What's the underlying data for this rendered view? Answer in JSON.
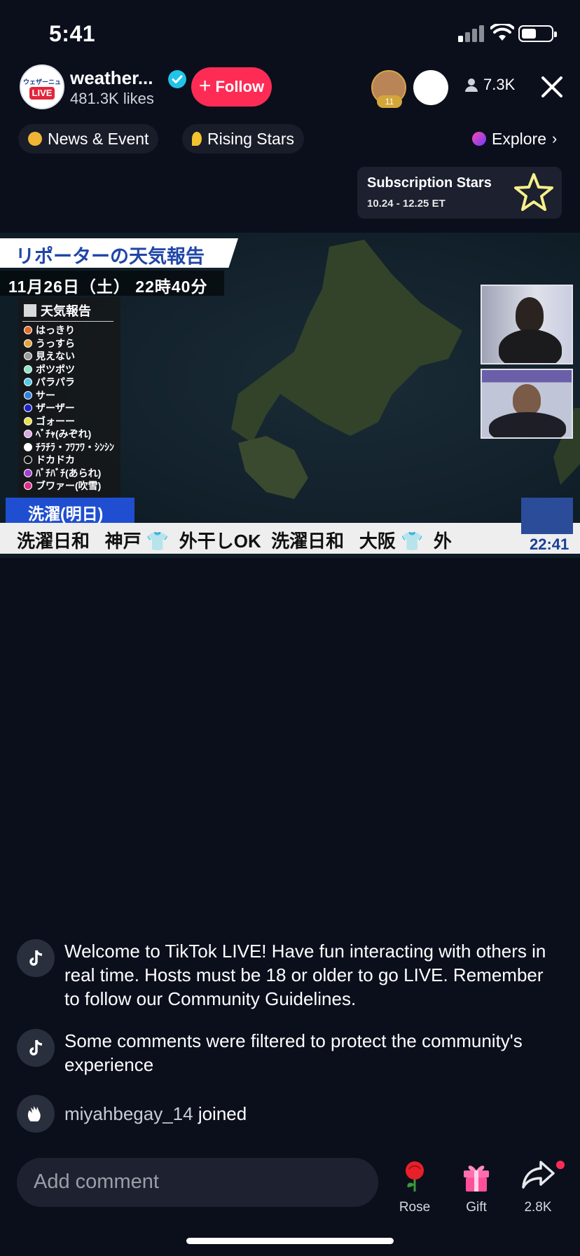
{
  "status": {
    "time": "5:41"
  },
  "header": {
    "host_name": "weather...",
    "host_likes": "481.3K likes",
    "avatar_top_text": "ウェザーニュース",
    "avatar_live_text": "LIVE",
    "follow_label": "Follow",
    "viewer_badge": "11",
    "viewer_count": "7.3K"
  },
  "categories": [
    {
      "label": "News & Event",
      "color": "#f0b535"
    },
    {
      "label": "Rising Stars",
      "color": "#f2c230"
    },
    {
      "label": "Explore",
      "color": "#e24fd0"
    }
  ],
  "subscription": {
    "title": "Subscription Stars",
    "dates": "10.24 - 12.25 ET"
  },
  "broadcast": {
    "title": "リポーターの天気報告",
    "date": "11月26日（土） 22時40分",
    "legend_title": "天気報告",
    "legend": [
      {
        "label": "はっきり",
        "color": "#e36b2b"
      },
      {
        "label": "うっすら",
        "color": "#e6a03a"
      },
      {
        "label": "見えない",
        "color": "#9a9a9a"
      },
      {
        "label": "ポツポツ",
        "color": "#8fe3c8"
      },
      {
        "label": "パラパラ",
        "color": "#55c8e8"
      },
      {
        "label": "サー",
        "color": "#2f7fe0"
      },
      {
        "label": "ザーザー",
        "color": "#1a23c8"
      },
      {
        "label": "ゴォーー",
        "color": "#e8e04a"
      },
      {
        "label": "ﾍﾞﾁｬ(みぞれ)",
        "color": "#d9a8e0"
      },
      {
        "label": "ﾁﾗﾁﾗ・ﾌﾜﾌﾜ・ｼﾝｼﾝ",
        "color": "#ffffff"
      },
      {
        "label": "ドカドカ",
        "color": "#111111"
      },
      {
        "label": "ﾊﾞﾁﾊﾞﾁ(あられ)",
        "color": "#a23fd0"
      },
      {
        "label": "ブワァー(吹雪)",
        "color": "#e02a8a"
      }
    ],
    "ticker_tag": "洗濯(明日)",
    "ticker_text": "洗濯日和   神戸 👕  外干しOK  洗濯日和   大阪 👕  外",
    "clock": "22:41"
  },
  "chat": [
    {
      "icon": "tiktok-icon",
      "text": "Welcome to TikTok LIVE! Have fun interacting with others in real time. Hosts must be 18 or older to go LIVE. Remember to follow our Community Guidelines."
    },
    {
      "icon": "tiktok-icon",
      "text": "Some comments were filtered to protect the community's experience"
    },
    {
      "icon": "wave-icon",
      "user": "miyahbegay_14",
      "action": "joined"
    }
  ],
  "bottom": {
    "comment_placeholder": "Add comment",
    "actions": [
      {
        "label": "Rose",
        "icon": "rose-icon"
      },
      {
        "label": "Gift",
        "icon": "gift-icon"
      },
      {
        "label": "2.8K",
        "icon": "share-icon"
      }
    ]
  }
}
